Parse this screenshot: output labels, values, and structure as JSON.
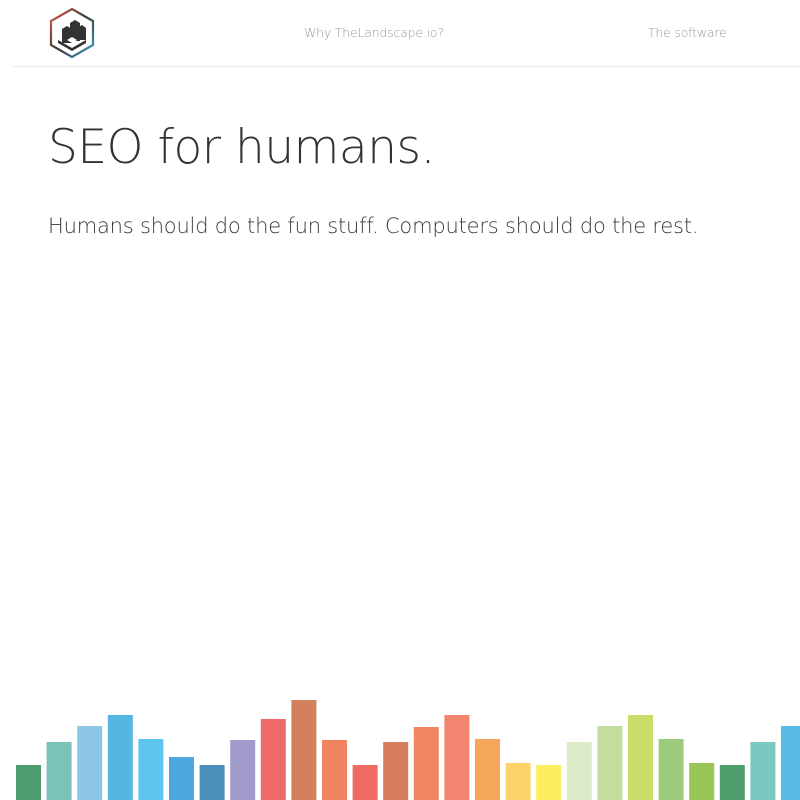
{
  "brand": {
    "logo_icon": "building-hexagon-icon"
  },
  "nav": {
    "items": [
      {
        "label": "Why TheLandscape.io?"
      },
      {
        "label": "The software"
      }
    ]
  },
  "hero": {
    "title": "SEO for humans.",
    "subtitle": "Humans should do the fun stuff. Computers should do the rest."
  },
  "decoration": {
    "skyline_colors": [
      "#4d9b6f",
      "#79c3b9",
      "#8ec6e7",
      "#54b6e1",
      "#5ec6ee",
      "#4fa8dd",
      "#4a8ebc",
      "#a09acb",
      "#ee6b6a",
      "#d3805d",
      "#f08460",
      "#ee6a62",
      "#d57d5c",
      "#f18663",
      "#f38670",
      "#f6a65a",
      "#fbd36a",
      "#fcec5e",
      "#deebc8",
      "#c2dd9e",
      "#c8de68",
      "#9ccb7b",
      "#98c556",
      "#4f9c6c",
      "#7cc8c1",
      "#57bbe4"
    ]
  }
}
